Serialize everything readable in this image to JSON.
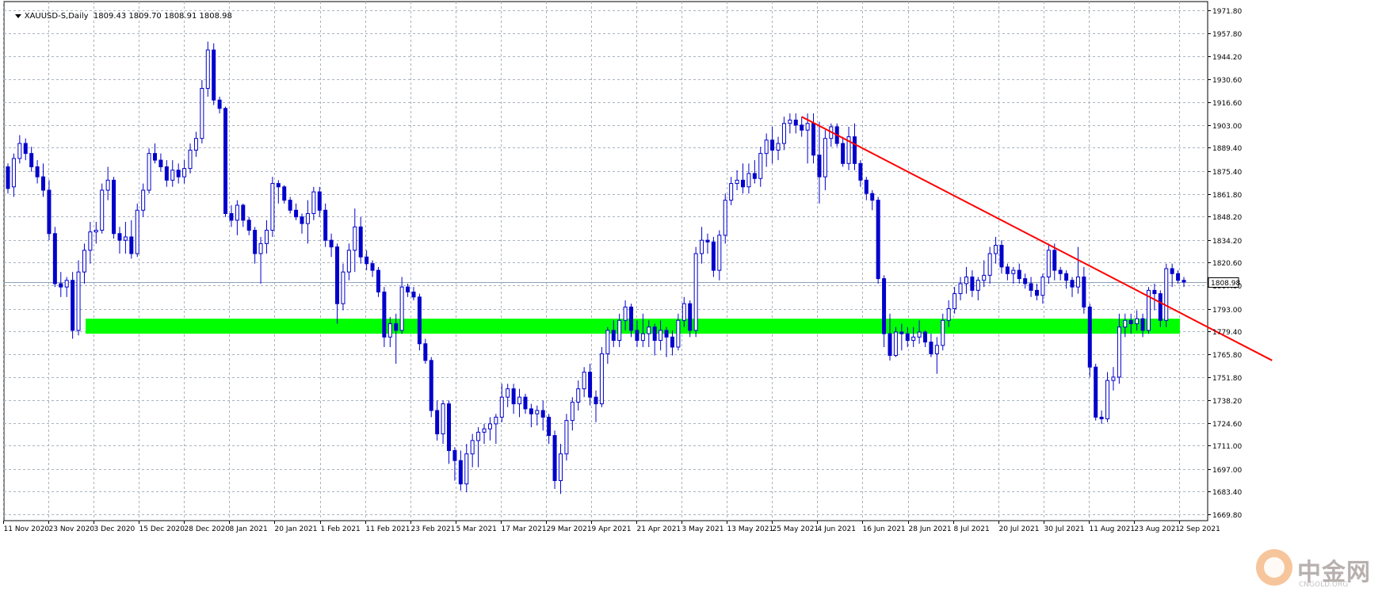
{
  "header": {
    "symbol": "XAUUSD-S,Daily",
    "ohlc": "1809.43 1809.70 1808.91 1808.98"
  },
  "current_price_label": "1808.98",
  "watermark": {
    "brand": "中金网",
    "sub": "CNGOLD.ORG"
  },
  "colors": {
    "candle": "#0000cc",
    "support_zone": "#00ff00",
    "trendline": "#ff0000",
    "grid": "#a9b3bd",
    "price_line": "#8fa2b8"
  },
  "chart_data": {
    "type": "candlestick",
    "ylim": [
      1666,
      1977
    ],
    "y_ticks": [
      "1971.80",
      "1957.80",
      "1944.20",
      "1930.60",
      "1916.60",
      "1903.00",
      "1889.40",
      "1875.40",
      "1861.80",
      "1848.20",
      "1834.20",
      "1820.60",
      "1807.00",
      "1793.00",
      "1779.40",
      "1765.80",
      "1751.80",
      "1738.20",
      "1724.60",
      "1711.00",
      "1697.00",
      "1683.40",
      "1669.80"
    ],
    "x_labels": [
      "11 Nov 2020",
      "23 Nov 2020",
      "3 Dec 2020",
      "15 Dec 2020",
      "28 Dec 2020",
      "8 Jan 2021",
      "20 Jan 2021",
      "1 Feb 2021",
      "11 Feb 2021",
      "23 Feb 2021",
      "5 Mar 2021",
      "17 Mar 2021",
      "29 Mar 2021",
      "9 Apr 2021",
      "21 Apr 2021",
      "3 May 2021",
      "13 May 2021",
      "25 May 2021",
      "4 Jun 2021",
      "16 Jun 2021",
      "28 Jun 2021",
      "8 Jul 2021",
      "20 Jul 2021",
      "30 Jul 2021",
      "11 Aug 2021",
      "23 Aug 2021",
      "2 Sep 2021"
    ],
    "support_zone": {
      "from": 1778,
      "to": 1787
    },
    "current_price": 1808.98,
    "trendline": {
      "start_bar": 135,
      "start_price": 1908,
      "end_bar": 215,
      "end_price": 1762
    },
    "candles": [
      [
        1878,
        1880,
        1862,
        1865
      ],
      [
        1866,
        1886,
        1860,
        1883
      ],
      [
        1883,
        1897,
        1880,
        1892
      ],
      [
        1892,
        1895,
        1882,
        1886
      ],
      [
        1886,
        1890,
        1875,
        1878
      ],
      [
        1878,
        1882,
        1868,
        1872
      ],
      [
        1872,
        1880,
        1860,
        1864
      ],
      [
        1864,
        1870,
        1834,
        1838
      ],
      [
        1838,
        1842,
        1806,
        1808
      ],
      [
        1808,
        1815,
        1800,
        1806
      ],
      [
        1806,
        1812,
        1800,
        1810
      ],
      [
        1810,
        1815,
        1775,
        1780
      ],
      [
        1780,
        1822,
        1777,
        1815
      ],
      [
        1815,
        1832,
        1808,
        1828
      ],
      [
        1828,
        1845,
        1820,
        1839
      ],
      [
        1839,
        1845,
        1832,
        1840
      ],
      [
        1840,
        1868,
        1838,
        1864
      ],
      [
        1864,
        1878,
        1858,
        1870
      ],
      [
        1870,
        1872,
        1835,
        1838
      ],
      [
        1838,
        1842,
        1826,
        1834
      ],
      [
        1834,
        1845,
        1826,
        1836
      ],
      [
        1836,
        1846,
        1823,
        1826
      ],
      [
        1826,
        1856,
        1824,
        1852
      ],
      [
        1852,
        1868,
        1848,
        1864
      ],
      [
        1864,
        1889,
        1862,
        1886
      ],
      [
        1886,
        1892,
        1880,
        1882
      ],
      [
        1882,
        1886,
        1875,
        1878
      ],
      [
        1878,
        1882,
        1866,
        1870
      ],
      [
        1870,
        1882,
        1866,
        1876
      ],
      [
        1876,
        1880,
        1868,
        1872
      ],
      [
        1872,
        1882,
        1868,
        1877
      ],
      [
        1877,
        1892,
        1874,
        1888
      ],
      [
        1888,
        1899,
        1884,
        1895
      ],
      [
        1895,
        1930,
        1892,
        1925
      ],
      [
        1925,
        1953,
        1920,
        1948
      ],
      [
        1948,
        1952,
        1915,
        1918
      ],
      [
        1918,
        1920,
        1910,
        1913
      ],
      [
        1913,
        1914,
        1848,
        1850
      ],
      [
        1850,
        1855,
        1842,
        1846
      ],
      [
        1846,
        1858,
        1837,
        1855
      ],
      [
        1855,
        1856,
        1842,
        1846
      ],
      [
        1846,
        1848,
        1837,
        1840
      ],
      [
        1840,
        1842,
        1820,
        1826
      ],
      [
        1826,
        1836,
        1808,
        1832
      ],
      [
        1832,
        1846,
        1826,
        1840
      ],
      [
        1840,
        1872,
        1836,
        1868
      ],
      [
        1868,
        1870,
        1856,
        1866
      ],
      [
        1866,
        1867,
        1856,
        1858
      ],
      [
        1858,
        1860,
        1850,
        1852
      ],
      [
        1852,
        1856,
        1846,
        1848
      ],
      [
        1848,
        1850,
        1838,
        1844
      ],
      [
        1844,
        1858,
        1832,
        1850
      ],
      [
        1850,
        1866,
        1846,
        1863
      ],
      [
        1863,
        1866,
        1848,
        1852
      ],
      [
        1852,
        1856,
        1830,
        1834
      ],
      [
        1834,
        1838,
        1824,
        1830
      ],
      [
        1830,
        1832,
        1784,
        1796
      ],
      [
        1796,
        1820,
        1792,
        1815
      ],
      [
        1815,
        1832,
        1810,
        1828
      ],
      [
        1828,
        1853,
        1815,
        1842
      ],
      [
        1842,
        1848,
        1820,
        1824
      ],
      [
        1824,
        1828,
        1816,
        1820
      ],
      [
        1820,
        1822,
        1812,
        1816
      ],
      [
        1816,
        1818,
        1800,
        1803
      ],
      [
        1803,
        1806,
        1770,
        1776
      ],
      [
        1776,
        1788,
        1770,
        1784
      ],
      [
        1784,
        1790,
        1760,
        1780
      ],
      [
        1780,
        1812,
        1778,
        1806
      ],
      [
        1806,
        1808,
        1800,
        1803
      ],
      [
        1803,
        1806,
        1798,
        1800
      ],
      [
        1800,
        1802,
        1768,
        1772
      ],
      [
        1772,
        1775,
        1760,
        1762
      ],
      [
        1762,
        1764,
        1728,
        1732
      ],
      [
        1732,
        1738,
        1714,
        1718
      ],
      [
        1718,
        1738,
        1712,
        1736
      ],
      [
        1736,
        1738,
        1700,
        1708
      ],
      [
        1708,
        1710,
        1690,
        1702
      ],
      [
        1702,
        1708,
        1684,
        1688
      ],
      [
        1688,
        1712,
        1683,
        1706
      ],
      [
        1706,
        1718,
        1698,
        1714
      ],
      [
        1714,
        1722,
        1698,
        1719
      ],
      [
        1719,
        1724,
        1712,
        1721
      ],
      [
        1721,
        1728,
        1714,
        1724
      ],
      [
        1724,
        1730,
        1712,
        1728
      ],
      [
        1728,
        1748,
        1725,
        1740
      ],
      [
        1740,
        1748,
        1734,
        1745
      ],
      [
        1745,
        1748,
        1730,
        1736
      ],
      [
        1736,
        1745,
        1728,
        1740
      ],
      [
        1740,
        1742,
        1730,
        1733
      ],
      [
        1733,
        1736,
        1722,
        1730
      ],
      [
        1730,
        1735,
        1723,
        1732
      ],
      [
        1732,
        1738,
        1720,
        1728
      ],
      [
        1728,
        1730,
        1712,
        1717
      ],
      [
        1717,
        1720,
        1685,
        1690
      ],
      [
        1690,
        1712,
        1682,
        1706
      ],
      [
        1706,
        1730,
        1702,
        1726
      ],
      [
        1726,
        1740,
        1720,
        1737
      ],
      [
        1737,
        1750,
        1732,
        1745
      ],
      [
        1745,
        1758,
        1740,
        1755
      ],
      [
        1755,
        1760,
        1735,
        1740
      ],
      [
        1740,
        1744,
        1725,
        1736
      ],
      [
        1736,
        1770,
        1734,
        1766
      ],
      [
        1766,
        1782,
        1760,
        1780
      ],
      [
        1780,
        1786,
        1770,
        1774
      ],
      [
        1774,
        1790,
        1770,
        1786
      ],
      [
        1786,
        1798,
        1780,
        1794
      ],
      [
        1794,
        1796,
        1776,
        1780
      ],
      [
        1780,
        1786,
        1770,
        1774
      ],
      [
        1774,
        1790,
        1770,
        1778
      ],
      [
        1778,
        1786,
        1770,
        1782
      ],
      [
        1782,
        1784,
        1765,
        1774
      ],
      [
        1774,
        1786,
        1768,
        1780
      ],
      [
        1780,
        1782,
        1764,
        1776
      ],
      [
        1776,
        1780,
        1765,
        1770
      ],
      [
        1770,
        1790,
        1768,
        1786
      ],
      [
        1786,
        1800,
        1782,
        1796
      ],
      [
        1796,
        1798,
        1776,
        1780
      ],
      [
        1780,
        1830,
        1776,
        1826
      ],
      [
        1826,
        1842,
        1820,
        1834
      ],
      [
        1834,
        1838,
        1826,
        1833
      ],
      [
        1833,
        1836,
        1812,
        1816
      ],
      [
        1816,
        1840,
        1810,
        1837
      ],
      [
        1837,
        1862,
        1832,
        1858
      ],
      [
        1858,
        1872,
        1855,
        1868
      ],
      [
        1868,
        1876,
        1864,
        1870
      ],
      [
        1870,
        1880,
        1862,
        1866
      ],
      [
        1866,
        1880,
        1862,
        1874
      ],
      [
        1874,
        1882,
        1868,
        1871
      ],
      [
        1871,
        1890,
        1866,
        1886
      ],
      [
        1886,
        1898,
        1878,
        1894
      ],
      [
        1894,
        1902,
        1880,
        1888
      ],
      [
        1888,
        1896,
        1882,
        1892
      ],
      [
        1892,
        1908,
        1888,
        1904
      ],
      [
        1904,
        1910,
        1898,
        1906
      ],
      [
        1906,
        1910,
        1898,
        1903
      ],
      [
        1903,
        1908,
        1896,
        1900
      ],
      [
        1900,
        1910,
        1880,
        1904
      ],
      [
        1904,
        1910,
        1880,
        1885
      ],
      [
        1885,
        1905,
        1856,
        1872
      ],
      [
        1872,
        1900,
        1864,
        1895
      ],
      [
        1895,
        1904,
        1890,
        1902
      ],
      [
        1902,
        1904,
        1890,
        1892
      ],
      [
        1892,
        1896,
        1878,
        1880
      ],
      [
        1880,
        1902,
        1876,
        1896
      ],
      [
        1896,
        1904,
        1876,
        1880
      ],
      [
        1880,
        1882,
        1866,
        1870
      ],
      [
        1870,
        1872,
        1858,
        1862
      ],
      [
        1862,
        1864,
        1852,
        1858
      ],
      [
        1858,
        1860,
        1808,
        1811
      ],
      [
        1811,
        1813,
        1770,
        1778
      ],
      [
        1778,
        1790,
        1762,
        1765
      ],
      [
        1765,
        1782,
        1764,
        1779
      ],
      [
        1779,
        1784,
        1768,
        1778
      ],
      [
        1778,
        1782,
        1770,
        1774
      ],
      [
        1774,
        1782,
        1770,
        1776
      ],
      [
        1776,
        1786,
        1772,
        1779
      ],
      [
        1779,
        1780,
        1770,
        1773
      ],
      [
        1773,
        1778,
        1764,
        1766
      ],
      [
        1766,
        1776,
        1754,
        1771
      ],
      [
        1771,
        1790,
        1768,
        1786
      ],
      [
        1786,
        1798,
        1782,
        1793
      ],
      [
        1793,
        1806,
        1790,
        1802
      ],
      [
        1802,
        1812,
        1798,
        1808
      ],
      [
        1808,
        1818,
        1802,
        1812
      ],
      [
        1812,
        1816,
        1800,
        1804
      ],
      [
        1804,
        1812,
        1798,
        1810
      ],
      [
        1810,
        1822,
        1806,
        1813
      ],
      [
        1813,
        1830,
        1808,
        1826
      ],
      [
        1826,
        1836,
        1820,
        1831
      ],
      [
        1831,
        1834,
        1814,
        1818
      ],
      [
        1818,
        1820,
        1810,
        1814
      ],
      [
        1814,
        1818,
        1808,
        1816
      ],
      [
        1816,
        1820,
        1808,
        1811
      ],
      [
        1811,
        1814,
        1805,
        1808
      ],
      [
        1808,
        1812,
        1800,
        1804
      ],
      [
        1804,
        1808,
        1798,
        1801
      ],
      [
        1801,
        1814,
        1796,
        1812
      ],
      [
        1812,
        1832,
        1808,
        1828
      ],
      [
        1828,
        1832,
        1810,
        1816
      ],
      [
        1816,
        1818,
        1810,
        1814
      ],
      [
        1814,
        1816,
        1805,
        1810
      ],
      [
        1810,
        1812,
        1800,
        1806
      ],
      [
        1806,
        1830,
        1802,
        1812
      ],
      [
        1812,
        1818,
        1790,
        1794
      ],
      [
        1794,
        1796,
        1752,
        1758
      ],
      [
        1758,
        1760,
        1726,
        1728
      ],
      [
        1728,
        1732,
        1724,
        1727
      ],
      [
        1727,
        1755,
        1725,
        1750
      ],
      [
        1750,
        1758,
        1744,
        1752
      ],
      [
        1752,
        1790,
        1748,
        1782
      ],
      [
        1782,
        1790,
        1776,
        1786
      ],
      [
        1786,
        1790,
        1778,
        1784
      ],
      [
        1784,
        1792,
        1780,
        1787
      ],
      [
        1787,
        1790,
        1776,
        1780
      ],
      [
        1780,
        1806,
        1778,
        1804
      ],
      [
        1804,
        1808,
        1792,
        1802
      ],
      [
        1802,
        1804,
        1782,
        1786
      ],
      [
        1786,
        1820,
        1782,
        1817
      ],
      [
        1817,
        1820,
        1806,
        1814
      ],
      [
        1814,
        1816,
        1808,
        1810
      ],
      [
        1810,
        1812,
        1806,
        1809
      ]
    ]
  }
}
